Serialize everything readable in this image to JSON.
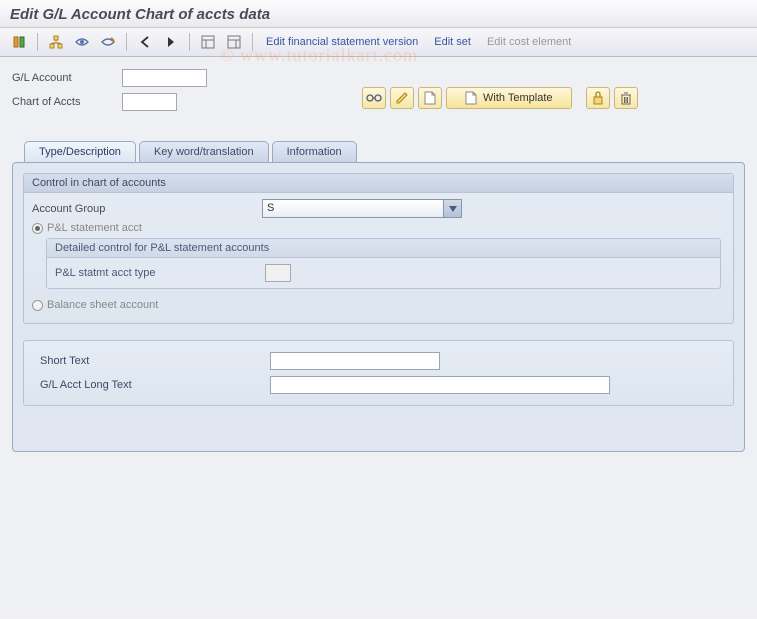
{
  "title": "Edit G/L Account Chart of accts data",
  "toolbar": {
    "edit_fsv": "Edit financial statement version",
    "edit_set": "Edit set",
    "edit_cost": "Edit cost element"
  },
  "fields": {
    "gl_account_label": "G/L Account",
    "gl_account_value": "",
    "chart_accts_label": "Chart of Accts",
    "chart_accts_value": ""
  },
  "buttons": {
    "with_template": "With Template"
  },
  "tabs": {
    "type_desc": "Type/Description",
    "keyword": "Key word/translation",
    "information": "Information"
  },
  "control_group": {
    "title": "Control in chart of accounts",
    "account_group_label": "Account Group",
    "account_group_value": "S",
    "pl_stmt_label": "P&L statement acct",
    "pl_detail_title": "Detailed control for P&L statement accounts",
    "pl_type_label": "P&L statmt acct type",
    "pl_type_value": "",
    "balance_label": "Balance sheet account"
  },
  "text_group": {
    "short_label": "Short Text",
    "short_value": "",
    "long_label": "G/L Acct Long Text",
    "long_value": ""
  },
  "watermark": "© www.tutorialkart.com"
}
